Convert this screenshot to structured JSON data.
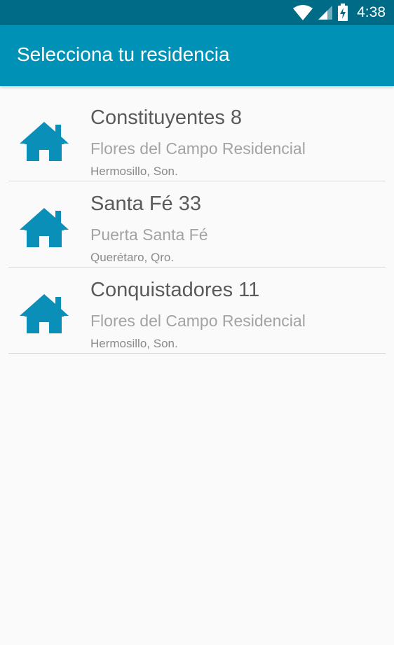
{
  "status_bar": {
    "time": "4:38",
    "icons": [
      "wifi-icon",
      "signal-icon",
      "battery-charging-icon"
    ]
  },
  "app_bar": {
    "title": "Selecciona tu residencia"
  },
  "colors": {
    "status_bar": "#006b86",
    "app_bar": "#0091b7",
    "accent": "#0a8fb8",
    "background": "#fafafa"
  },
  "residences": [
    {
      "icon": "house-icon",
      "name": "Constituyentes 8",
      "development": "Flores del Campo Residencial",
      "city": "Hermosillo, Son."
    },
    {
      "icon": "house-icon",
      "name": "Santa Fé 33",
      "development": "Puerta Santa Fé",
      "city": "Querétaro, Qro."
    },
    {
      "icon": "house-icon",
      "name": "Conquistadores 11",
      "development": "Flores del Campo Residencial",
      "city": "Hermosillo, Son."
    }
  ]
}
